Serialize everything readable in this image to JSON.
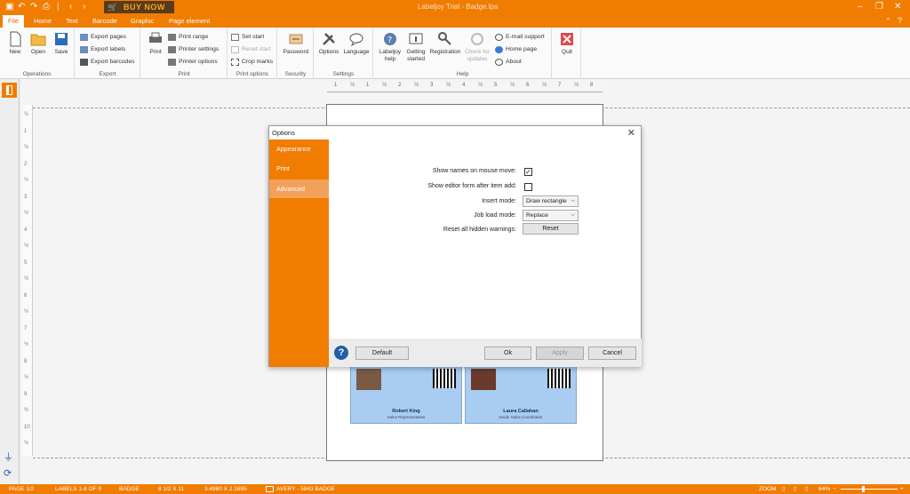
{
  "app": {
    "title": "Labeljoy Trial - Badge.lpa",
    "buy_now": "BUY NOW"
  },
  "menu": {
    "tabs": [
      "File",
      "Home",
      "Text",
      "Barcode",
      "Graphic",
      "Page element"
    ]
  },
  "ribbon": {
    "operations": {
      "label": "Operations",
      "new": "New",
      "open": "Open",
      "save": "Save"
    },
    "export": {
      "label": "Export",
      "export_pages": "Export pages",
      "export_labels": "Export labels",
      "export_barcodes": "Export barcodes"
    },
    "print": {
      "label": "Print",
      "print": "Print",
      "print_range": "Print range",
      "printer_settings": "Printer settings",
      "printer_options": "Printer options"
    },
    "print_options": {
      "label": "Print options",
      "set_start": "Set start",
      "reset_start": "Reset start",
      "crop_marks": "Crop marks"
    },
    "security": {
      "label": "Security",
      "password": "Password"
    },
    "settings": {
      "label": "Settings",
      "options": "Options",
      "language": "Language"
    },
    "help": {
      "label": "Help",
      "labeljoy_help_1": "Labeljoy",
      "labeljoy_help_2": "help",
      "getting_started_1": "Getting",
      "getting_started_2": "started",
      "registration": "Registration",
      "check_updates_1": "Check for",
      "check_updates_2": "updates",
      "email_support": "E-mail support",
      "home_page": "Home page",
      "about": "About"
    },
    "quit": "Quit"
  },
  "ruler": {
    "h_ticks": [
      "1",
      "½",
      "1",
      "½",
      "2",
      "½",
      "3",
      "½",
      "4",
      "½",
      "5",
      "½",
      "6",
      "½",
      "7",
      "½",
      "8"
    ],
    "v_ticks": [
      "½",
      "1",
      "½",
      "2",
      "½",
      "3",
      "½",
      "4",
      "½",
      "5",
      "½",
      "6",
      "½",
      "7",
      "½",
      "8",
      "½",
      "9",
      "½",
      "10",
      "½"
    ]
  },
  "badges": [
    {
      "name": "Robert King",
      "role": "Sales Representative"
    },
    {
      "name": "Laura Callahan",
      "role": "Inside Sales Coordinator"
    }
  ],
  "dialog": {
    "title": "Options",
    "nav": [
      "Appearance",
      "Print",
      "Advanced"
    ],
    "selected_nav": "Advanced",
    "options": {
      "show_names_label": "Show names on mouse move:",
      "show_names_checked": true,
      "show_editor_label": "Show editor form after item add:",
      "show_editor_checked": false,
      "insert_mode_label": "Insert mode:",
      "insert_mode_value": "Draw rectangle",
      "job_load_label": "Job load mode:",
      "job_load_value": "Replace",
      "reset_warnings_label": "Reset all hidden warnings:",
      "reset_button": "Reset"
    },
    "footer": {
      "help": "?",
      "default": "Default",
      "ok": "Ok",
      "apply": "Apply",
      "cancel": "Cancel"
    }
  },
  "status": {
    "page": "PAGE 1/2",
    "labels": "LABELS 1-8 OF 9",
    "type": "BADGE",
    "paper": "8 1/2 X 11",
    "size": "3.4980 X 2.1695",
    "template": "AVERY - 5843 BADGE",
    "zoom_label": "ZOOM",
    "zoom_value": "64%"
  },
  "colors": {
    "accent": "#f07c00",
    "nav_selected": "#f3a05a",
    "badge": "#a9ccf2"
  }
}
